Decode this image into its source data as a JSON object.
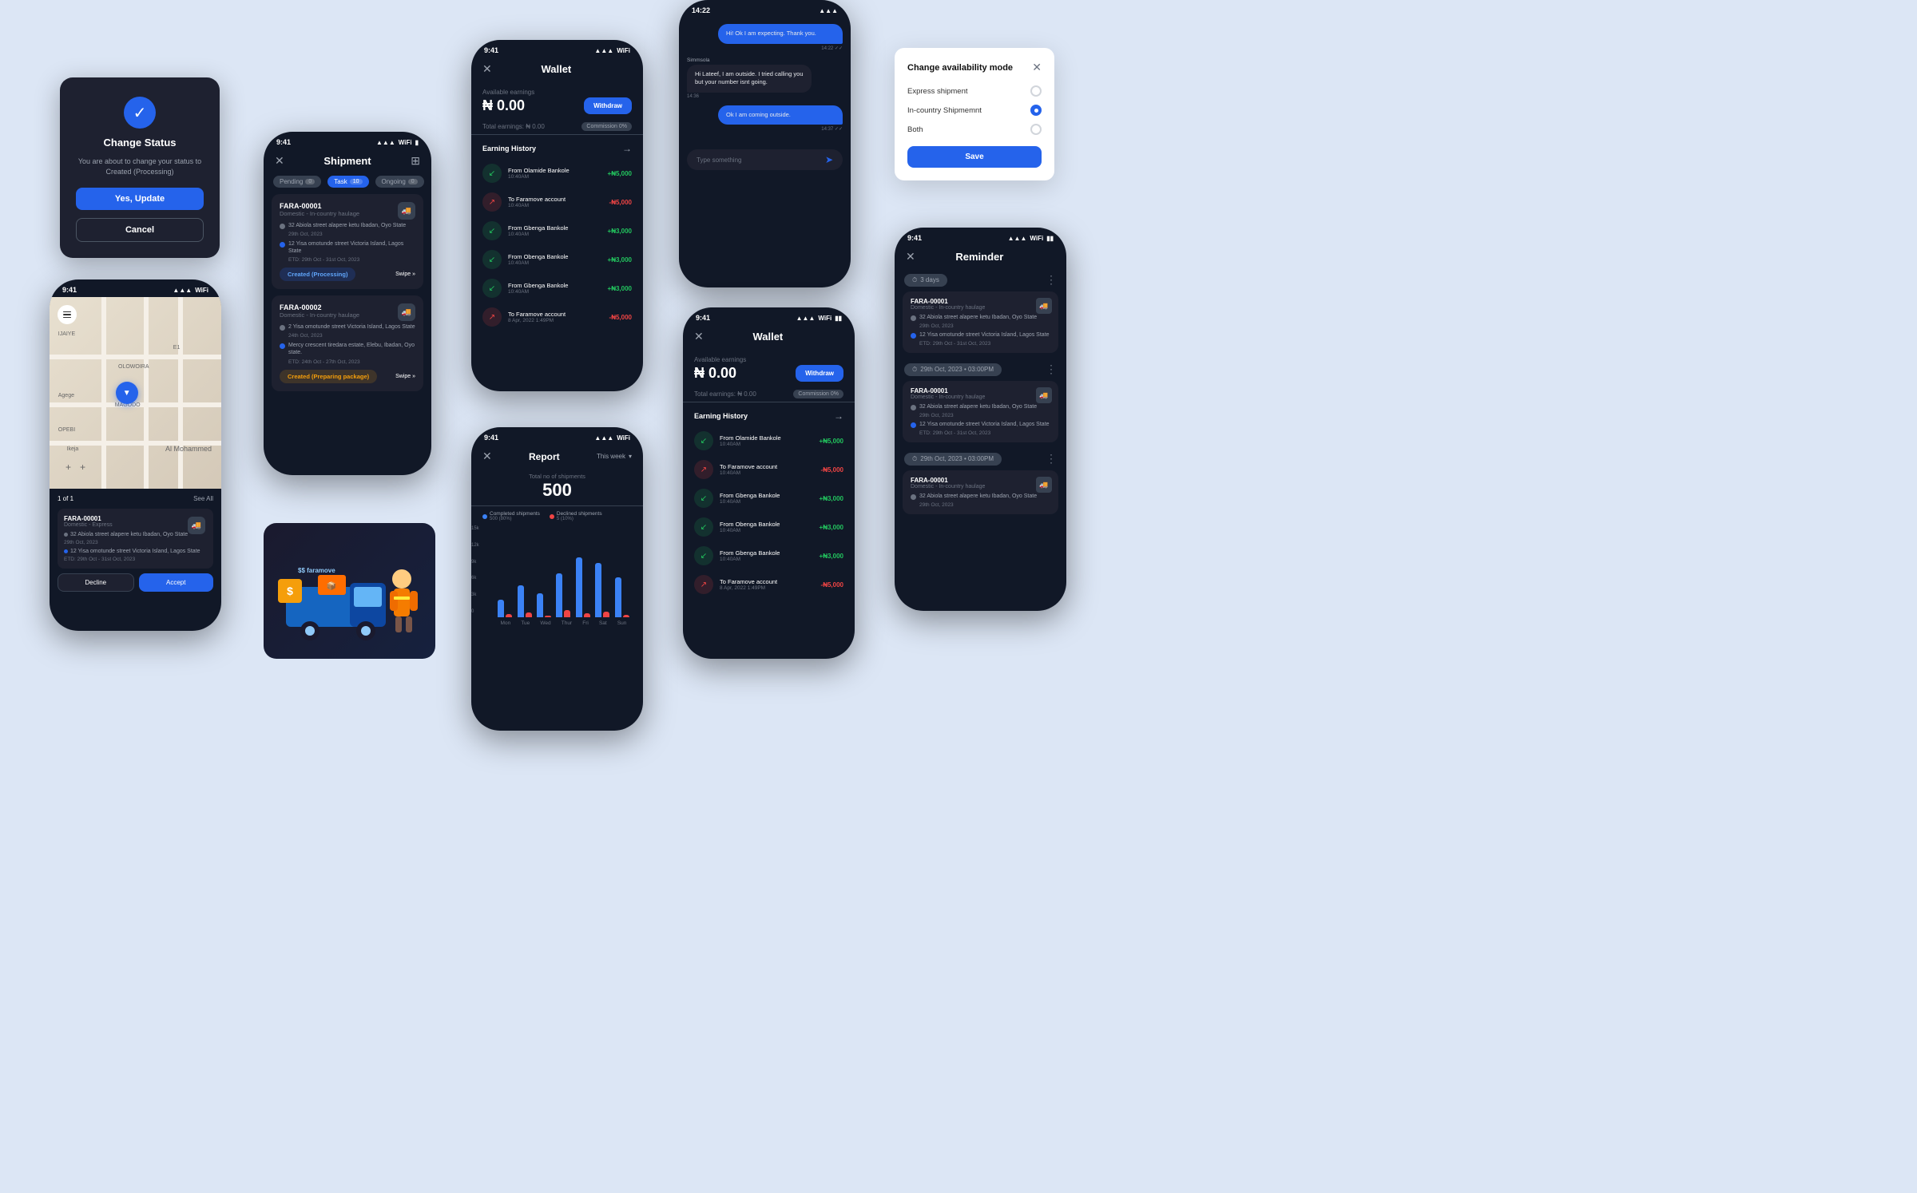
{
  "changeStatus": {
    "title": "Change Status",
    "subtitle": "You are about to change your status to Created (Processing)",
    "confirmLabel": "Yes, Update",
    "cancelLabel": "Cancel"
  },
  "mapPhone": {
    "time": "9:41",
    "paginationLabel": "1 of 1",
    "seeAllLabel": "See All",
    "shipment": {
      "id": "FARA-00001",
      "type": "Domestic - Express",
      "from": "32 Abiola street alapere ketu Ibadan, Oyo State",
      "to": "12 Yisa omotunde street Victoria Island, Lagos State",
      "etd": "ETD: 29th Oct - 31st Oct, 2023"
    },
    "declineLabel": "Decline",
    "acceptLabel": "Accept"
  },
  "shipmentPhone": {
    "time": "9:41",
    "title": "Shipment",
    "tabs": [
      "Pending",
      "Task",
      "Ongoing"
    ],
    "tabCounts": [
      0,
      10,
      0
    ],
    "cards": [
      {
        "id": "FARA-00001",
        "type": "Domestic - In-country haulage",
        "from": "32 Abiola street alapere ketu Ibadan, Oyo State",
        "fromDate": "29th Oct, 2023",
        "to": "12 Yisa omotunde street Victoria Island, Lagos State",
        "etd": "ETD: 29th Oct - 31st Oct, 2023",
        "status": "Created (Processing)",
        "swipe": "Swipe"
      },
      {
        "id": "FARA-00002",
        "type": "Domestic - In-country haulage",
        "from": "2 Yisa omotunde street Victoria Island, Lagos State",
        "fromDate": "24th Oct, 2023",
        "to": "Mercy crescent tiredara estate, Elebu, Ibadan, Oyo state.",
        "etd": "ETD: 24th Oct - 27th Oct, 2023",
        "status": "Created (Preparing package)",
        "swipe": "Swipe"
      }
    ]
  },
  "walletTopPhone": {
    "time": "9:41",
    "availableEarningsLabel": "Available earnings",
    "amount": "₦ 0.00",
    "withdrawLabel": "Withdraw",
    "totalEarningsLabel": "Total earnings: ₦ 0.00",
    "commissionLabel": "Commission 0%",
    "earningHistoryTitle": "Earning History",
    "earnings": [
      {
        "name": "From Olamide Bankole",
        "time": "10:40AM",
        "amount": "+₦5,000",
        "type": "positive"
      },
      {
        "name": "To Faramove account",
        "time": "10:40AM",
        "amount": "-₦5,000",
        "type": "negative"
      },
      {
        "name": "From Gbenga Bankole",
        "time": "10:40AM",
        "amount": "+₦3,000",
        "type": "positive"
      },
      {
        "name": "From Obenga Bankole",
        "time": "10:40AM",
        "amount": "+₦3,000",
        "type": "positive"
      },
      {
        "name": "From Gbenga Bankole",
        "time": "10:40AM",
        "amount": "+₦3,000",
        "type": "positive"
      },
      {
        "name": "To Faramove account",
        "time": "8 Apr, 2022 1:49PM",
        "amount": "-₦5,000",
        "type": "negative"
      }
    ]
  },
  "chatPhone": {
    "messages": [
      {
        "text": "Hi! Ok I am expecting. Thank you.",
        "time": "14:22",
        "side": "right"
      },
      {
        "text": "Hi Lateef, I am outside. I tried calling you but your number isnt going.",
        "time": "14:36",
        "side": "left",
        "sender": "Simmsola"
      },
      {
        "text": "Ok I am coming outside.",
        "time": "14:37",
        "side": "right"
      }
    ],
    "inputPlaceholder": "Type something"
  },
  "availabilityModal": {
    "title": "Change availability mode",
    "options": [
      {
        "label": "Express shipment",
        "selected": false
      },
      {
        "label": "In-country Shipmemnt",
        "selected": true
      },
      {
        "label": "Both",
        "selected": false
      }
    ],
    "saveLabel": "Save"
  },
  "walletRightPhone": {
    "time": "9:41",
    "availableEarningsLabel": "Available earnings",
    "amount": "₦ 0.00",
    "withdrawLabel": "Withdraw",
    "totalEarningsLabel": "Total earnings: ₦ 0.00",
    "commissionLabel": "Commission 0%",
    "earningHistoryTitle": "Earning History",
    "earnings": [
      {
        "name": "From Olamide Bankole",
        "time": "10:40AM",
        "amount": "+₦5,000",
        "type": "positive"
      },
      {
        "name": "To Faramove account",
        "time": "10:40AM",
        "amount": "-₦5,000",
        "type": "negative"
      },
      {
        "name": "From Gbenga Bankole",
        "time": "10:40AM",
        "amount": "+₦3,000",
        "type": "positive"
      },
      {
        "name": "From Obenga Bankole",
        "time": "10:40AM",
        "amount": "+₦3,000",
        "type": "positive"
      },
      {
        "name": "From Gbenga Bankole",
        "time": "10:40AM",
        "amount": "+₦3,000",
        "type": "positive"
      },
      {
        "name": "To Faramove account",
        "time": "8 Apr, 2022 1:49PM",
        "amount": "-₦5,000",
        "type": "negative"
      }
    ]
  },
  "reportPhone": {
    "time": "9:41",
    "title": "Report",
    "weekLabel": "This week",
    "totalShipmentsLabel": "Total no of shipments",
    "totalNumber": "500",
    "completedLabel": "Completed shipments",
    "completedValue": "500 (80%)",
    "declinedLabel": "Declined shipments",
    "declinedValue": "5 (10%)",
    "chartDays": [
      "Mon",
      "Tue",
      "Wed",
      "Thur",
      "Fri",
      "Sat",
      "Sun"
    ],
    "chartBlueValues": [
      30,
      55,
      40,
      70,
      90,
      85,
      65
    ],
    "chartRedValues": [
      5,
      8,
      3,
      12,
      6,
      9,
      4
    ],
    "yLabels": [
      "15k",
      "12k",
      "9k",
      "6k",
      "3k",
      "0"
    ]
  },
  "reminderPhone": {
    "time": "9:41",
    "title": "Reminder",
    "sections": [
      {
        "badge": "3 days",
        "card": {
          "id": "FARA-00001",
          "type": "Domestic - In-country haulage",
          "from": "32 Abiola street alapere ketu Ibadan, Oyo State",
          "fromDate": "29th Oct, 2023",
          "to": "12 Yisa omotunde street Victoria Island, Lagos State",
          "etd": "ETD: 29th Oct - 31st Oct, 2023"
        }
      },
      {
        "badge": "29th Oct, 2023 • 03:00PM",
        "card": {
          "id": "FARA-00001",
          "type": "Domestic - In-country haulage",
          "from": "32 Abiola street alapere ketu Ibadan, Oyo State",
          "fromDate": "29th Oct, 2023",
          "to": "12 Yisa omotunde street Victoria Island, Lagos State",
          "etd": "ETD: 29th Oct - 31st Oct, 2023"
        }
      },
      {
        "badge": "29th Oct, 2023 • 03:00PM",
        "card": {
          "id": "FARA-00001",
          "type": "Domestic - In-country haulage",
          "from": "32 Abiola street alapere ketu Ibadan, Oyo State",
          "fromDate": "29th Oct, 2023",
          "to": "",
          "etd": ""
        }
      }
    ]
  }
}
